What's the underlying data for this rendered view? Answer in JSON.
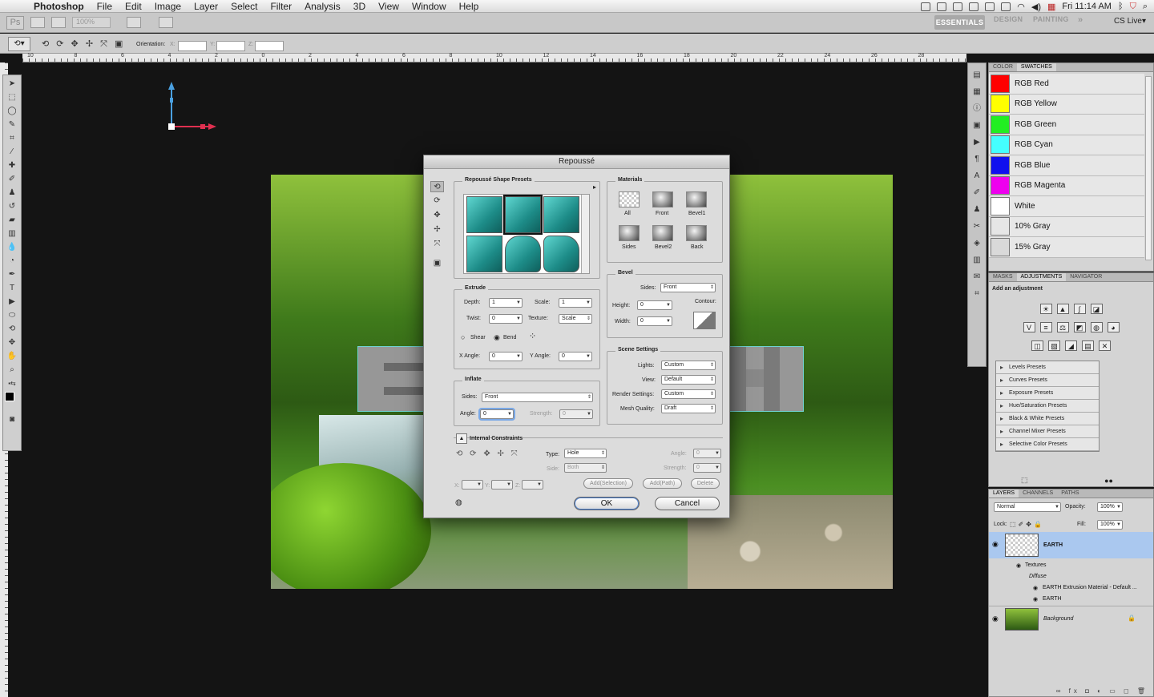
{
  "menubar": {
    "app": "Photoshop",
    "items": [
      "File",
      "Edit",
      "Image",
      "Layer",
      "Select",
      "Filter",
      "Analysis",
      "3D",
      "View",
      "Window",
      "Help"
    ],
    "clock": "Fri 11:14 AM"
  },
  "appbar": {
    "ps": "Ps",
    "zoom": "100%",
    "workspaces": [
      "ESSENTIALS",
      "DESIGN",
      "PAINTING"
    ],
    "cs_live": "CS Live▾"
  },
  "options": {
    "orientation_label": "Orientation:",
    "x": "X:",
    "y": "Y:",
    "z": "Z:"
  },
  "ruler_labels": [
    "10",
    "8",
    "6",
    "4",
    "2",
    "0",
    "2",
    "4",
    "6",
    "8",
    "10",
    "12",
    "14",
    "16",
    "18",
    "20",
    "22",
    "24",
    "26",
    "28"
  ],
  "canvas": {
    "letter_left": "E",
    "letter_right": "H"
  },
  "swatch_panel": {
    "tabs": [
      "COLOR",
      "SWATCHES"
    ],
    "swatches": [
      {
        "name": "RGB Red",
        "color": "#ff0000"
      },
      {
        "name": "RGB Yellow",
        "color": "#ffff00"
      },
      {
        "name": "RGB Green",
        "color": "#22ee22"
      },
      {
        "name": "RGB Cyan",
        "color": "#44ffff"
      },
      {
        "name": "RGB Blue",
        "color": "#1010ee"
      },
      {
        "name": "RGB Magenta",
        "color": "#ee00ee"
      },
      {
        "name": "White",
        "color": "#ffffff"
      },
      {
        "name": "10% Gray",
        "color": "#e6e6e6"
      },
      {
        "name": "15% Gray",
        "color": "#d9d9d9"
      }
    ]
  },
  "adjustments_panel": {
    "tabs": [
      "MASKS",
      "ADJUSTMENTS",
      "NAVIGATOR"
    ],
    "heading": "Add an adjustment",
    "presets": [
      "Levels Presets",
      "Curves Presets",
      "Exposure Presets",
      "Hue/Saturation Presets",
      "Black & White Presets",
      "Channel Mixer Presets",
      "Selective Color Presets"
    ]
  },
  "layers_panel": {
    "tabs": [
      "LAYERS",
      "CHANNELS",
      "PATHS"
    ],
    "blend_mode": "Normal",
    "opacity_label": "Opacity:",
    "opacity": "100%",
    "lock_label": "Lock:",
    "fill_label": "Fill:",
    "fill": "100%",
    "layers": [
      {
        "name": "EARTH"
      },
      {
        "name": "Textures"
      },
      {
        "name": "Diffuse"
      },
      {
        "name": "EARTH Extrusion Material - Default ..."
      },
      {
        "name": "EARTH"
      },
      {
        "name": "Background"
      }
    ]
  },
  "dialog": {
    "title": "Repoussé",
    "shape_presets_title": "Repoussé Shape Presets",
    "materials_title": "Materials",
    "materials": [
      "All",
      "Front",
      "Bevel1",
      "Sides",
      "Bevel2",
      "Back"
    ],
    "extrude": {
      "title": "Extrude",
      "depth_label": "Depth:",
      "depth": "1",
      "scale_label": "Scale:",
      "scale": "1",
      "twist_label": "Twist:",
      "twist": "0",
      "texture_label": "Texture:",
      "texture": "Scale",
      "shear": "Shear",
      "bend": "Bend",
      "xangle_label": "X Angle:",
      "xangle": "0",
      "yangle_label": "Y Angle:",
      "yangle": "0"
    },
    "inflate": {
      "title": "Inflate",
      "sides_label": "Sides:",
      "sides": "Front",
      "angle_label": "Angle:",
      "angle": "0",
      "strength_label": "Strength:",
      "strength": "0"
    },
    "bevel": {
      "title": "Bevel",
      "sides_label": "Sides:",
      "sides": "Front",
      "height_label": "Height:",
      "height": "0",
      "width_label": "Width:",
      "width": "0",
      "contour_label": "Contour:"
    },
    "scene": {
      "title": "Scene Settings",
      "lights_label": "Lights:",
      "lights": "Custom",
      "view_label": "View:",
      "view": "Default",
      "render_label": "Render Settings:",
      "render": "Custom",
      "mesh_label": "Mesh Quality:",
      "mesh": "Draft"
    },
    "constraints": {
      "title": "Internal Constraints",
      "type_label": "Type:",
      "type": "Hole",
      "side_label": "Side:",
      "side": "Both",
      "angle_label": "Angle:",
      "angle": "0",
      "strength_label": "Strength:",
      "strength": "0",
      "x": "X:",
      "y": "Y:",
      "z": "Z:",
      "add_selection": "Add(Selection)",
      "add_path": "Add(Path)",
      "delete": "Delete"
    },
    "ok": "OK",
    "cancel": "Cancel"
  }
}
